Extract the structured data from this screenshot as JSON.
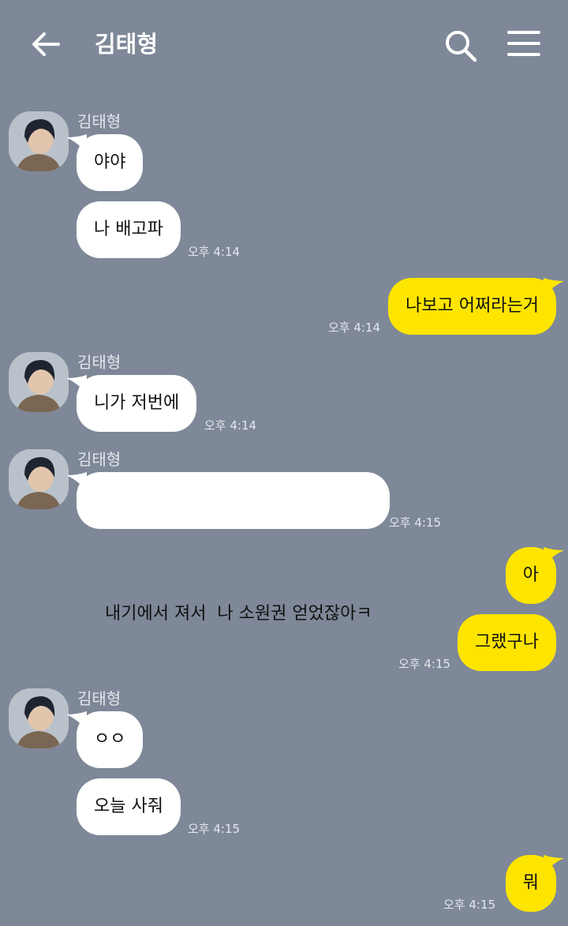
{
  "header": {
    "title": "김태형",
    "back_icon": "arrow-left-icon",
    "search_icon": "search-icon",
    "menu_icon": "hamburger-menu-icon"
  },
  "colors": {
    "background": "#7e8898",
    "incoming_bubble": "#ffffff",
    "outgoing_bubble": "#fee500"
  },
  "messages": [
    {
      "from": "김태형",
      "direction": "in",
      "text": "야야",
      "time": ""
    },
    {
      "from": "김태형",
      "direction": "in",
      "text": "나 배고파",
      "time": "오후 4:14"
    },
    {
      "from": "me",
      "direction": "out",
      "text": "나보고 어쩌라는거",
      "time": "오후 4:14"
    },
    {
      "from": "김태형",
      "direction": "in",
      "text": "니가 저번에",
      "time": "오후 4:14"
    },
    {
      "from": "김태형",
      "direction": "in",
      "text": "내기에서 져서  나 소원권 얻었잖아ㅋ",
      "time": "오후 4:15"
    },
    {
      "from": "me",
      "direction": "out",
      "text": "아",
      "time": ""
    },
    {
      "from": "me",
      "direction": "out",
      "text": "그랬구나",
      "time": "오후 4:15"
    },
    {
      "from": "김태형",
      "direction": "in",
      "text": "ㅇㅇ",
      "time": ""
    },
    {
      "from": "김태형",
      "direction": "in",
      "text": "오늘 사줘",
      "time": "오후 4:15"
    },
    {
      "from": "me",
      "direction": "out",
      "text": "뭐",
      "time": "오후 4:15"
    }
  ]
}
